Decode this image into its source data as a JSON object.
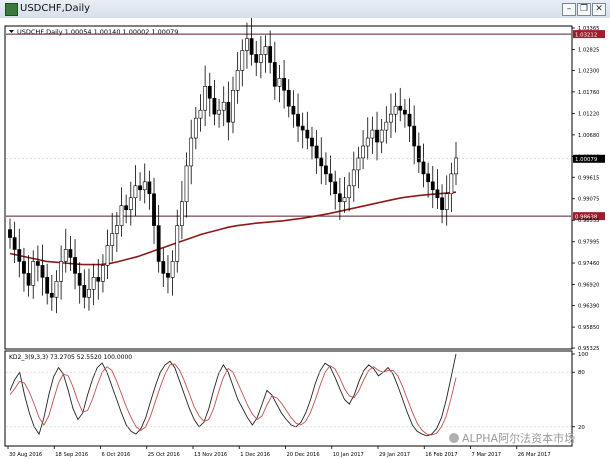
{
  "window": {
    "title": "USDCHF,Daily",
    "minimize_glyph": "–",
    "restore_glyph": "❐",
    "close_glyph": "✕"
  },
  "header": {
    "symbol_line": "USDCHF,Daily  1.00054 1.00140 1.00002 1.00079"
  },
  "colors": {
    "candle": "#000000",
    "moving_average": "#8b1a1a",
    "level": "#5a1a2a",
    "label_box": "#9b1f2f",
    "stoch_k": "#222222",
    "stoch_d": "#c05050"
  },
  "chart_data": [
    {
      "type": "candlestick",
      "title": "USDCHF,Daily",
      "x_ticks": [
        "30 Aug 2016",
        "18 Sep 2016",
        "6 Oct 2016",
        "25 Oct 2016",
        "13 Nov 2016",
        "1 Dec 2016",
        "20 Dec 2016",
        "10 Jan 2017",
        "29 Jan 2017",
        "16 Feb 2017",
        "7 Mar 2017",
        "26 Mar 2017"
      ],
      "y_ticks": [
        "1.03365",
        "1.02825",
        "1.02300",
        "1.01760",
        "1.01220",
        "1.00680",
        "1.00140",
        "0.99615",
        "0.99075",
        "0.98535",
        "0.97995",
        "0.97460",
        "0.96920",
        "0.96390",
        "0.95850",
        "0.95325"
      ],
      "ylim": [
        0.95325,
        1.03365
      ],
      "current_price_label": "1.00079",
      "levels": [
        {
          "label": "1.03212",
          "value": 1.03212
        },
        {
          "label": "0.98638",
          "value": 0.98638
        }
      ],
      "close": [
        0.981,
        0.978,
        0.975,
        0.972,
        0.969,
        0.975,
        0.974,
        0.971,
        0.967,
        0.966,
        0.97,
        0.975,
        0.978,
        0.976,
        0.972,
        0.969,
        0.966,
        0.968,
        0.971,
        0.97,
        0.974,
        0.979,
        0.982,
        0.984,
        0.989,
        0.988,
        0.991,
        0.994,
        0.993,
        0.995,
        0.992,
        0.984,
        0.975,
        0.972,
        0.971,
        0.975,
        0.984,
        0.99,
        0.999,
        1.006,
        1.011,
        1.013,
        1.019,
        1.016,
        1.012,
        1.013,
        1.015,
        1.01,
        1.018,
        1.023,
        1.028,
        1.031,
        1.027,
        1.025,
        1.027,
        1.029,
        1.025,
        1.019,
        1.021,
        1.018,
        1.014,
        1.012,
        1.009,
        1.008,
        1.006,
        1.004,
        1.001,
        0.999,
        0.997,
        0.995,
        0.992,
        0.99,
        0.991,
        0.994,
        0.998,
        1.001,
        1.004,
        1.006,
        1.008,
        1.005,
        1.008,
        1.01,
        1.012,
        1.014,
        1.013,
        1.012,
        1.009,
        1.004,
        1.0,
        0.997,
        0.995,
        0.993,
        0.991,
        0.988,
        0.992,
        0.997,
        1.001
      ],
      "moving_average": [
        0.977,
        0.9765,
        0.976,
        0.9755,
        0.975,
        0.9748,
        0.9746,
        0.9744,
        0.9742,
        0.9742,
        0.9742,
        0.9745,
        0.975,
        0.9756,
        0.9762,
        0.977,
        0.9778,
        0.9786,
        0.9794,
        0.9802,
        0.981,
        0.9818,
        0.9824,
        0.983,
        0.9836,
        0.984,
        0.9843,
        0.9846,
        0.9848,
        0.985,
        0.9852,
        0.9855,
        0.9858,
        0.9862,
        0.9866,
        0.987,
        0.9875,
        0.988,
        0.9885,
        0.989,
        0.9895,
        0.99,
        0.9905,
        0.991,
        0.9913,
        0.9916,
        0.9918,
        0.992,
        0.9922,
        0.9924
      ]
    },
    {
      "type": "line",
      "title": "KD2_3(9,3,3) 73.2705 52.5520 100.0000",
      "y_ticks": [
        "100",
        "80",
        "20"
      ],
      "ylim": [
        0,
        100
      ],
      "series": [
        {
          "values": [
            60,
            72,
            80,
            55,
            35,
            20,
            12,
            30,
            55,
            75,
            85,
            78,
            60,
            40,
            28,
            35,
            55,
            72,
            85,
            90,
            80,
            65,
            50,
            35,
            22,
            15,
            12,
            18,
            30,
            48,
            65,
            80,
            88,
            92,
            85,
            70,
            55,
            40,
            28,
            20,
            25,
            40,
            60,
            78,
            88,
            80,
            65,
            50,
            40,
            30,
            22,
            30,
            45,
            60,
            55,
            45,
            35,
            28,
            22,
            20,
            25,
            35,
            50,
            68,
            82,
            90,
            86,
            75,
            62,
            50,
            45,
            55,
            70,
            82,
            88,
            84,
            76,
            80,
            85,
            78,
            65,
            50,
            35,
            22,
            15,
            12,
            10,
            12,
            18,
            30,
            50,
            75,
            100
          ]
        },
        {
          "values": [
            55,
            62,
            70,
            68,
            58,
            45,
            30,
            22,
            32,
            50,
            68,
            78,
            76,
            64,
            48,
            36,
            38,
            50,
            66,
            80,
            86,
            82,
            70,
            56,
            42,
            30,
            20,
            16,
            20,
            32,
            48,
            64,
            78,
            88,
            89,
            82,
            70,
            56,
            42,
            32,
            26,
            28,
            40,
            58,
            74,
            84,
            80,
            68,
            56,
            44,
            34,
            28,
            32,
            44,
            54,
            52,
            46,
            38,
            30,
            24,
            22,
            26,
            36,
            50,
            66,
            80,
            87,
            84,
            74,
            62,
            54,
            52,
            60,
            72,
            82,
            86,
            82,
            80,
            82,
            82,
            76,
            64,
            50,
            36,
            24,
            16,
            12,
            11,
            13,
            20,
            32,
            52,
            74
          ]
        }
      ]
    }
  ],
  "watermark": "ALPHA阿尔法资本市场"
}
